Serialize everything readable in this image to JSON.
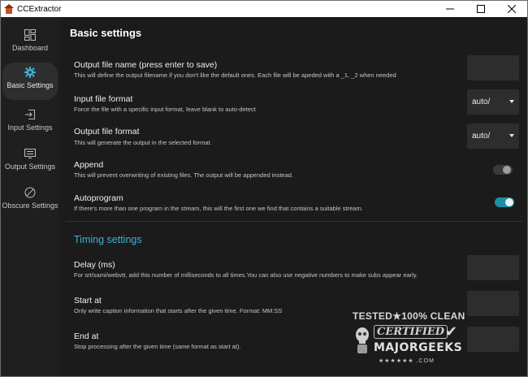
{
  "window": {
    "title": "CCExtractor"
  },
  "sidebar": {
    "items": [
      {
        "label": "Dashboard",
        "icon": "dashboard-icon"
      },
      {
        "label": "Basic Settings",
        "icon": "gear-icon"
      },
      {
        "label": "Input Settings",
        "icon": "input-icon"
      },
      {
        "label": "Output Settings",
        "icon": "output-icon"
      },
      {
        "label": "Obscure Settings",
        "icon": "obscure-icon"
      }
    ],
    "active_index": 1
  },
  "main": {
    "title": "Basic settings",
    "settings": [
      {
        "title": "Output file name (press enter to save)",
        "desc": "This will define the output filename if you don't like the default ones. Each file will be apeded with a _1, _2 when needed",
        "control": "text",
        "value": ""
      },
      {
        "title": "Input file format",
        "desc": "Force the file with a specific input format, leave blank to auto-detect",
        "control": "select",
        "value": "auto/"
      },
      {
        "title": "Output file format",
        "desc": "This will generate the output in the selected format.",
        "control": "select",
        "value": "auto/"
      },
      {
        "title": "Append",
        "desc": "This will prevent overwriting of existing files. The output will be appended instead.",
        "control": "toggle",
        "value": false
      },
      {
        "title": "Autoprogram",
        "desc": "If there's more than one program in the stream, this will the first one we find that contains a suitable stream.",
        "control": "toggle",
        "value": true
      }
    ],
    "timing": {
      "title": "Timing settings",
      "settings": [
        {
          "title": "Delay (ms)",
          "desc": "For srt/sami/webvtt, add this number of milliseconds to all times.You can also use negative numbers to make subs appear early.",
          "control": "text",
          "value": ""
        },
        {
          "title": "Start at",
          "desc": "Only write caption information that starts after the given time. Format: MM:SS",
          "control": "text",
          "value": ""
        },
        {
          "title": "End at",
          "desc": "Stop processing after the given time (same format as start at).",
          "control": "text",
          "value": ""
        }
      ]
    }
  },
  "watermark": {
    "top": "TESTED★100% CLEAN",
    "middle": "CERTIFIED",
    "bottom": "MAJORGEEKS",
    "stars": "★★★★★★ .COM"
  },
  "colors": {
    "accent": "#3cb0d6",
    "toggle_on": "#1b8fa6",
    "background": "#1b1b1b",
    "sidebar": "#1f1f1f",
    "control": "#2d2d2d"
  }
}
